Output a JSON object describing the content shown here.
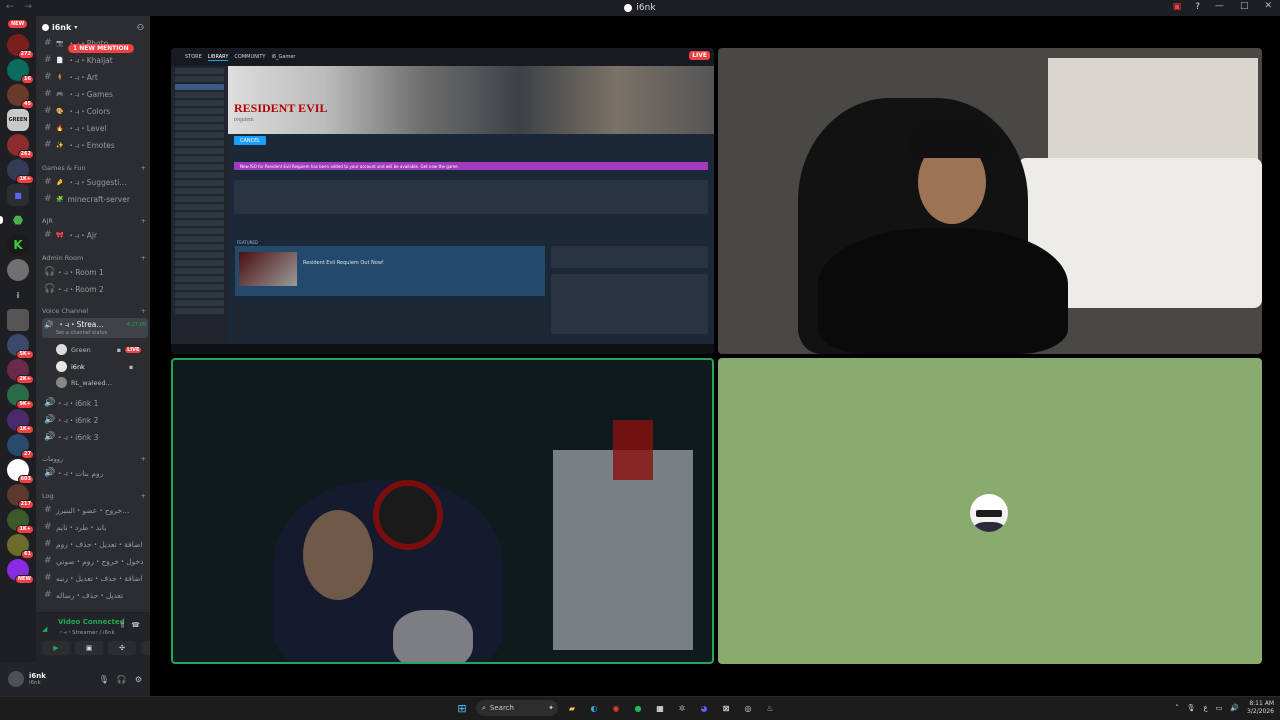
{
  "window": {
    "title": "i6nk",
    "nav": "← →",
    "controls": [
      "—",
      "□",
      "✕"
    ]
  },
  "rail": {
    "badges": [
      "NEW",
      "272",
      "16",
      "45",
      "262",
      "1K+",
      "5K+",
      "2K+",
      "9K+",
      "1K+",
      "27",
      "603",
      "217",
      "1K+",
      "61",
      "NEW"
    ]
  },
  "sidebar": {
    "server_name": "i6nk",
    "mention_pill": "1 NEW MENTION",
    "channels_top": [
      {
        "label": "・⥽・Photo",
        "emoji": "📷"
      },
      {
        "label": "・⥽・Khaljat",
        "emoji": "📄"
      },
      {
        "label": "・⥽・Art",
        "emoji": "🧍"
      },
      {
        "label": "・⥽・Games",
        "emoji": "🎮"
      },
      {
        "label": "・⥽・Colors",
        "emoji": "🎨"
      },
      {
        "label": "・⥽・Level",
        "emoji": "🔥"
      },
      {
        "label": "・⥽・Emotes",
        "emoji": "✨"
      }
    ],
    "cat_games": "Games & Fun",
    "channels_games": [
      {
        "label": "・⥽・Suggesti…",
        "emoji": "🤌"
      },
      {
        "label": "minecraft-server",
        "emoji": "🧩"
      }
    ],
    "cat_ajr": "AJR",
    "channel_ajr": {
      "label": "・⥽・Ajr",
      "emoji": "🎀"
    },
    "cat_admin": "Admin Room",
    "channels_admin": [
      "・⥽・Room 1",
      "・⥽・Room 2"
    ],
    "cat_voice": "Voice Channel",
    "voice_active": {
      "label": "・⥽・Strea…",
      "time": "4:27:09",
      "status": "Set a channel status"
    },
    "voice_users": [
      {
        "name": "Green",
        "live": "LIVE"
      },
      {
        "name": "i6nk",
        "live": ""
      },
      {
        "name": "RL_waleed…",
        "live": ""
      }
    ],
    "voice_channels": [
      "・⥽・i6nk 1",
      "・⥽・i6nk 2",
      "・⥽・i6nk 3"
    ],
    "cat_rooms": "روومات",
    "voice_room": "・⥽・روم بنات",
    "cat_log": "Log",
    "log_channels": [
      "خروج・عضو・البنيرز…",
      "باند・طرد・تايم",
      "اضافة・تعديل・حذف・روم",
      "دخول・خروج・روم・صوتي",
      "اضافة・حذف・تعديل・رتبه",
      "تعديل・حذف・رساله"
    ]
  },
  "voice_panel": {
    "status": "Video Connected",
    "sub": "・⥽・Streamer / i6nk"
  },
  "user_panel": {
    "name": "i6nk",
    "tag": "i6nk"
  },
  "stage": {
    "live_label": "LIVE",
    "steam": {
      "nav": [
        "STORE",
        "LIBRARY",
        "COMMUNITY",
        "i6_Gamer"
      ],
      "game_logo_1": "RESIDENT EVIL",
      "game_logo_2": "requiem",
      "play_label": "CANCEL",
      "notice": "New ISO for Resident Evil Requiem has been added to your account and will be available. Get now the game.",
      "featured_title": "Resident Evil Requiem Out Now!",
      "featured_label": "FEATURED"
    }
  },
  "taskbar": {
    "search": "Search",
    "time": "8:11 AM",
    "date": "3/2/2026"
  }
}
